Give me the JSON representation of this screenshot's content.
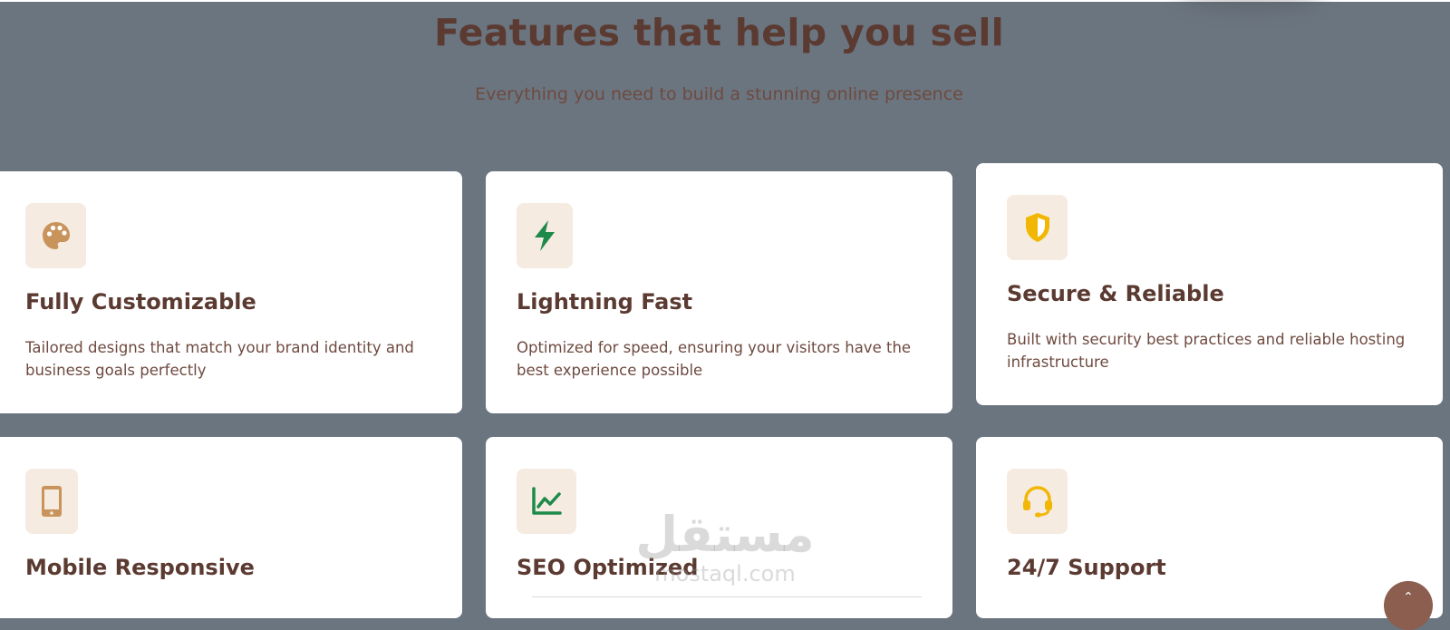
{
  "section": {
    "title": "Features that help you sell",
    "subtitle": "Everything you need to build a stunning online presence"
  },
  "features": [
    {
      "icon": "palette-icon",
      "title": "Fully Customizable",
      "description": "Tailored designs that match your brand identity and business goals perfectly",
      "icon_color": "#c9945c"
    },
    {
      "icon": "lightning-icon",
      "title": "Lightning Fast",
      "description": "Optimized for speed, ensuring your visitors have the best experience possible",
      "icon_color": "#1e8a4a"
    },
    {
      "icon": "shield-icon",
      "title": "Secure & Reliable",
      "description": "Built with security best practices and reliable hosting infrastructure",
      "icon_color": "#f2b705"
    },
    {
      "icon": "mobile-icon",
      "title": "Mobile Responsive",
      "description": "",
      "icon_color": "#c9945c"
    },
    {
      "icon": "chart-line-icon",
      "title": "SEO Optimized",
      "description": "",
      "icon_color": "#1e8a4a"
    },
    {
      "icon": "headset-icon",
      "title": "24/7 Support",
      "description": "",
      "icon_color": "#f2b705"
    }
  ],
  "watermark": {
    "arabic": "مستقل",
    "latin": "mostaql.com"
  },
  "scroll_top": {
    "glyph": "⌃"
  },
  "colors": {
    "background": "#6b7580",
    "heading": "#5b3a31",
    "body_text": "#6e4a3f",
    "icon_bg": "#f5ebe0",
    "card_bg": "#ffffff"
  }
}
